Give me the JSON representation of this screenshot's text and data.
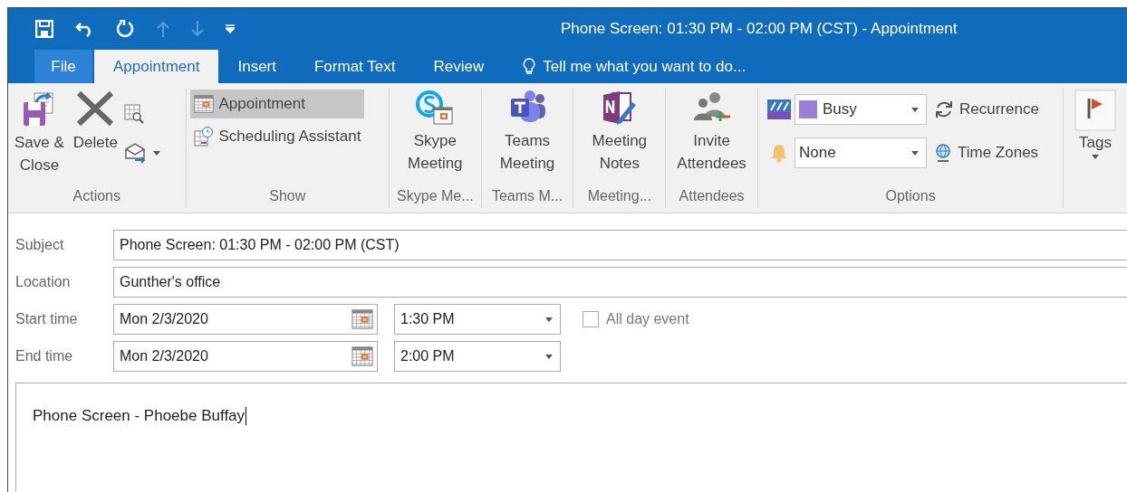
{
  "window": {
    "title": "Phone Screen: 01:30 PM - 02:00 PM (CST) - Appointment"
  },
  "tabs": [
    {
      "label": "File",
      "kind": "file",
      "selected": false
    },
    {
      "label": "Appointment",
      "kind": "tab",
      "selected": true
    },
    {
      "label": "Insert",
      "kind": "tab",
      "selected": false
    },
    {
      "label": "Format Text",
      "kind": "tab",
      "selected": false
    },
    {
      "label": "Review",
      "kind": "tab",
      "selected": false
    }
  ],
  "tell_me": {
    "placeholder": "Tell me what you want to do..."
  },
  "ribbon": {
    "actions": {
      "label": "Actions",
      "save_close": "Save &\nClose",
      "delete": "Delete"
    },
    "show": {
      "label": "Show",
      "items": [
        {
          "label": "Appointment",
          "kind": "appointment",
          "selected": true
        },
        {
          "label": "Scheduling Assistant",
          "kind": "scheduling",
          "selected": false
        }
      ]
    },
    "large_groups": [
      {
        "kind": "skype",
        "button": "Skype\nMeeting",
        "label": "Skype Me..."
      },
      {
        "kind": "teams",
        "button": "Teams\nMeeting",
        "label": "Teams M..."
      },
      {
        "kind": "onenote",
        "button": "Meeting\nNotes",
        "label": "Meeting..."
      },
      {
        "kind": "invite",
        "button": "Invite\nAttendees",
        "label": "Attendees"
      }
    ],
    "options": {
      "label": "Options",
      "show_as": {
        "value": "Busy",
        "color": "#9b7fd4"
      },
      "reminder": {
        "value": "None"
      },
      "recurrence": "Recurrence",
      "time_zones": "Time Zones"
    },
    "tags": {
      "label": "Tags"
    }
  },
  "form": {
    "subject": {
      "label": "Subject",
      "value": "Phone Screen: 01:30 PM - 02:00 PM (CST)"
    },
    "location": {
      "label": "Location",
      "value": "Gunther's office"
    },
    "start": {
      "label": "Start time",
      "date": "Mon 2/3/2020",
      "time": "1:30 PM"
    },
    "end": {
      "label": "End time",
      "date": "Mon 2/3/2020",
      "time": "2:00 PM"
    },
    "all_day": {
      "label": "All day event",
      "checked": false
    }
  },
  "body": {
    "value": "Phone Screen - Phoebe Buffay"
  }
}
